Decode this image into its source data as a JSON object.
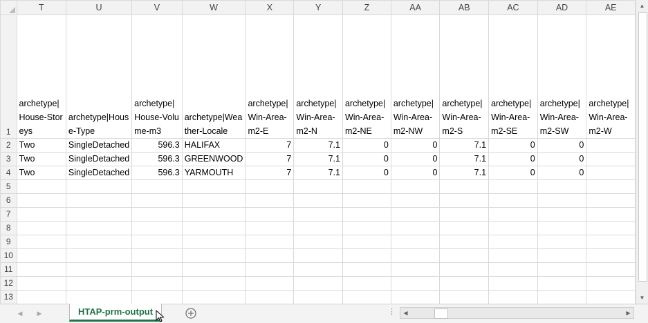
{
  "columns": [
    "T",
    "U",
    "V",
    "W",
    "X",
    "Y",
    "Z",
    "AA",
    "AB",
    "AC",
    "AD",
    "AE"
  ],
  "row_numbers": [
    "1",
    "2",
    "3",
    "4",
    "5",
    "6",
    "7",
    "8",
    "9",
    "10",
    "11",
    "12",
    "13"
  ],
  "header_cells": [
    "archetype|House-Storeys",
    "archetype|House-Type",
    "archetype|House-Volume-m3",
    "archetype|Weather-Locale",
    "archetype|Win-Area-m2-E",
    "archetype|Win-Area-m2-N",
    "archetype|Win-Area-m2-NE",
    "archetype|Win-Area-m2-NW",
    "archetype|Win-Area-m2-S",
    "archetype|Win-Area-m2-SE",
    "archetype|Win-Area-m2-SW",
    "archetype|Win-Area-m2-W"
  ],
  "rows": [
    [
      "Two",
      "SingleDetached",
      "596.3",
      "HALIFAX",
      "7",
      "7.1",
      "0",
      "0",
      "7.1",
      "0",
      "0",
      ""
    ],
    [
      "Two",
      "SingleDetached",
      "596.3",
      "GREENWOOD",
      "7",
      "7.1",
      "0",
      "0",
      "7.1",
      "0",
      "0",
      ""
    ],
    [
      "Two",
      "SingleDetached",
      "596.3",
      "YARMOUTH",
      "7",
      "7.1",
      "0",
      "0",
      "7.1",
      "0",
      "0",
      ""
    ]
  ],
  "sheet_tab": {
    "label": "HTAP-prm-output"
  },
  "icons": {
    "nav_prev": "triangle-left-icon",
    "nav_next": "triangle-right-icon",
    "add_sheet": "plus-circle-icon",
    "scroll_up": "triangle-up-icon",
    "scroll_down": "triangle-down-icon",
    "scroll_left": "triangle-left-icon",
    "scroll_right": "triangle-right-icon"
  },
  "colors": {
    "accent": "#217346",
    "header_bg": "#f2f2f2",
    "gridline": "#d9d9d9"
  }
}
